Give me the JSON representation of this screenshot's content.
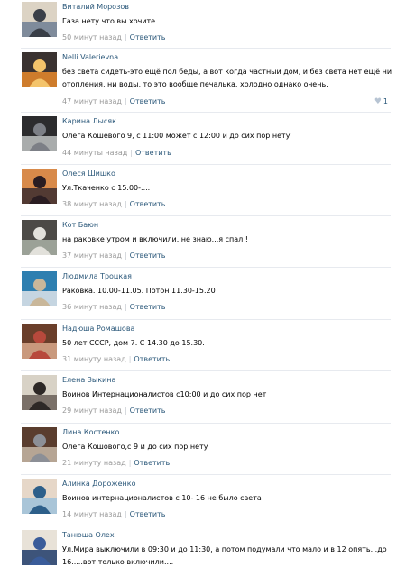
{
  "comments": [
    {
      "author": "Виталий Морозов",
      "text": "Газа нету что вы хочите",
      "time": "50 минут назад",
      "reply": "Ответить",
      "colors": [
        "#6f7e94",
        "#dcd3c4",
        "#3a3f48"
      ]
    },
    {
      "author": "Nelli Valerievna",
      "text": "без света сидеть-это ещё пол беды, а вот когда частный дом, и без света нет ещё ни отопления, ни воды, то это вообще печалька. холодно однако очень.",
      "time": "47 минут назад",
      "reply": "Ответить",
      "likes": "1",
      "like_icon": "heart-icon",
      "colors": [
        "#e98a2c",
        "#3a3230",
        "#f4c46b"
      ]
    },
    {
      "author": "Карина Лысяк",
      "text": "Олега Кошевого 9, с 11:00 может с 12:00 и до сих пор нету",
      "time": "44 минуты назад",
      "reply": "Ответить",
      "colors": [
        "#bfc3c2",
        "#2c2c2e",
        "#7c7f86"
      ]
    },
    {
      "author": "Олеся Шишко",
      "text": "Ул.Ткаченко с 15.00-....",
      "time": "38 минут назад",
      "reply": "Ответить",
      "colors": [
        "#3b2b2f",
        "#d88a4a",
        "#2a1d22"
      ]
    },
    {
      "author": "Кот Баюн",
      "text": "на раковке утром и включили..не знаю...я спал !",
      "time": "37 минут назад",
      "reply": "Ответить",
      "colors": [
        "#a9b0a6",
        "#4c4a46",
        "#e2e1db"
      ]
    },
    {
      "author": "Людмила Троцкая",
      "text": "Раковка. 10.00-11.05. Потон 11.30-15.20",
      "time": "36 минут назад",
      "reply": "Ответить",
      "colors": [
        "#dfe4ea",
        "#2e7fb0",
        "#c9b79a"
      ]
    },
    {
      "author": "Надюша Ромашова",
      "text": "50 лет СССР, дом 7. С 14.30 до 15.30.",
      "time": "31 минуту назад",
      "reply": "Ответить",
      "colors": [
        "#d9a98c",
        "#6a3e2a",
        "#b8493c"
      ]
    },
    {
      "author": "Елена Зыкина",
      "text": "Воинов Интернационалистов с10:00 и до сих пор нет",
      "time": "29 минут назад",
      "reply": "Ответить",
      "colors": [
        "#6a5f57",
        "#d8d2c6",
        "#2d2826"
      ]
    },
    {
      "author": "Лина Костенко",
      "text": "Олега Кошового,с 9 и до сих пор нету",
      "time": "21 минуту назад",
      "reply": "Ответить",
      "colors": [
        "#c7b7a6",
        "#5a3d2e",
        "#8c8f96"
      ]
    },
    {
      "author": "Алинка Дороженко",
      "text": "Воинов интернационалистов с 10- 16 не было света",
      "time": "14 минут назад",
      "reply": "Ответить",
      "colors": [
        "#9ec2da",
        "#e6d7c8",
        "#2d5f8a"
      ]
    },
    {
      "author": "Танюша Олех",
      "text": "Ул.Мира выключили в 09:30 и до 11:30, а потом подумали что мало и в 12 опять...до 16.....вот только включили....",
      "time": "",
      "reply": "",
      "colors": [
        "#1f3b6a",
        "#e8e2d8",
        "#3a5c9a"
      ]
    }
  ]
}
